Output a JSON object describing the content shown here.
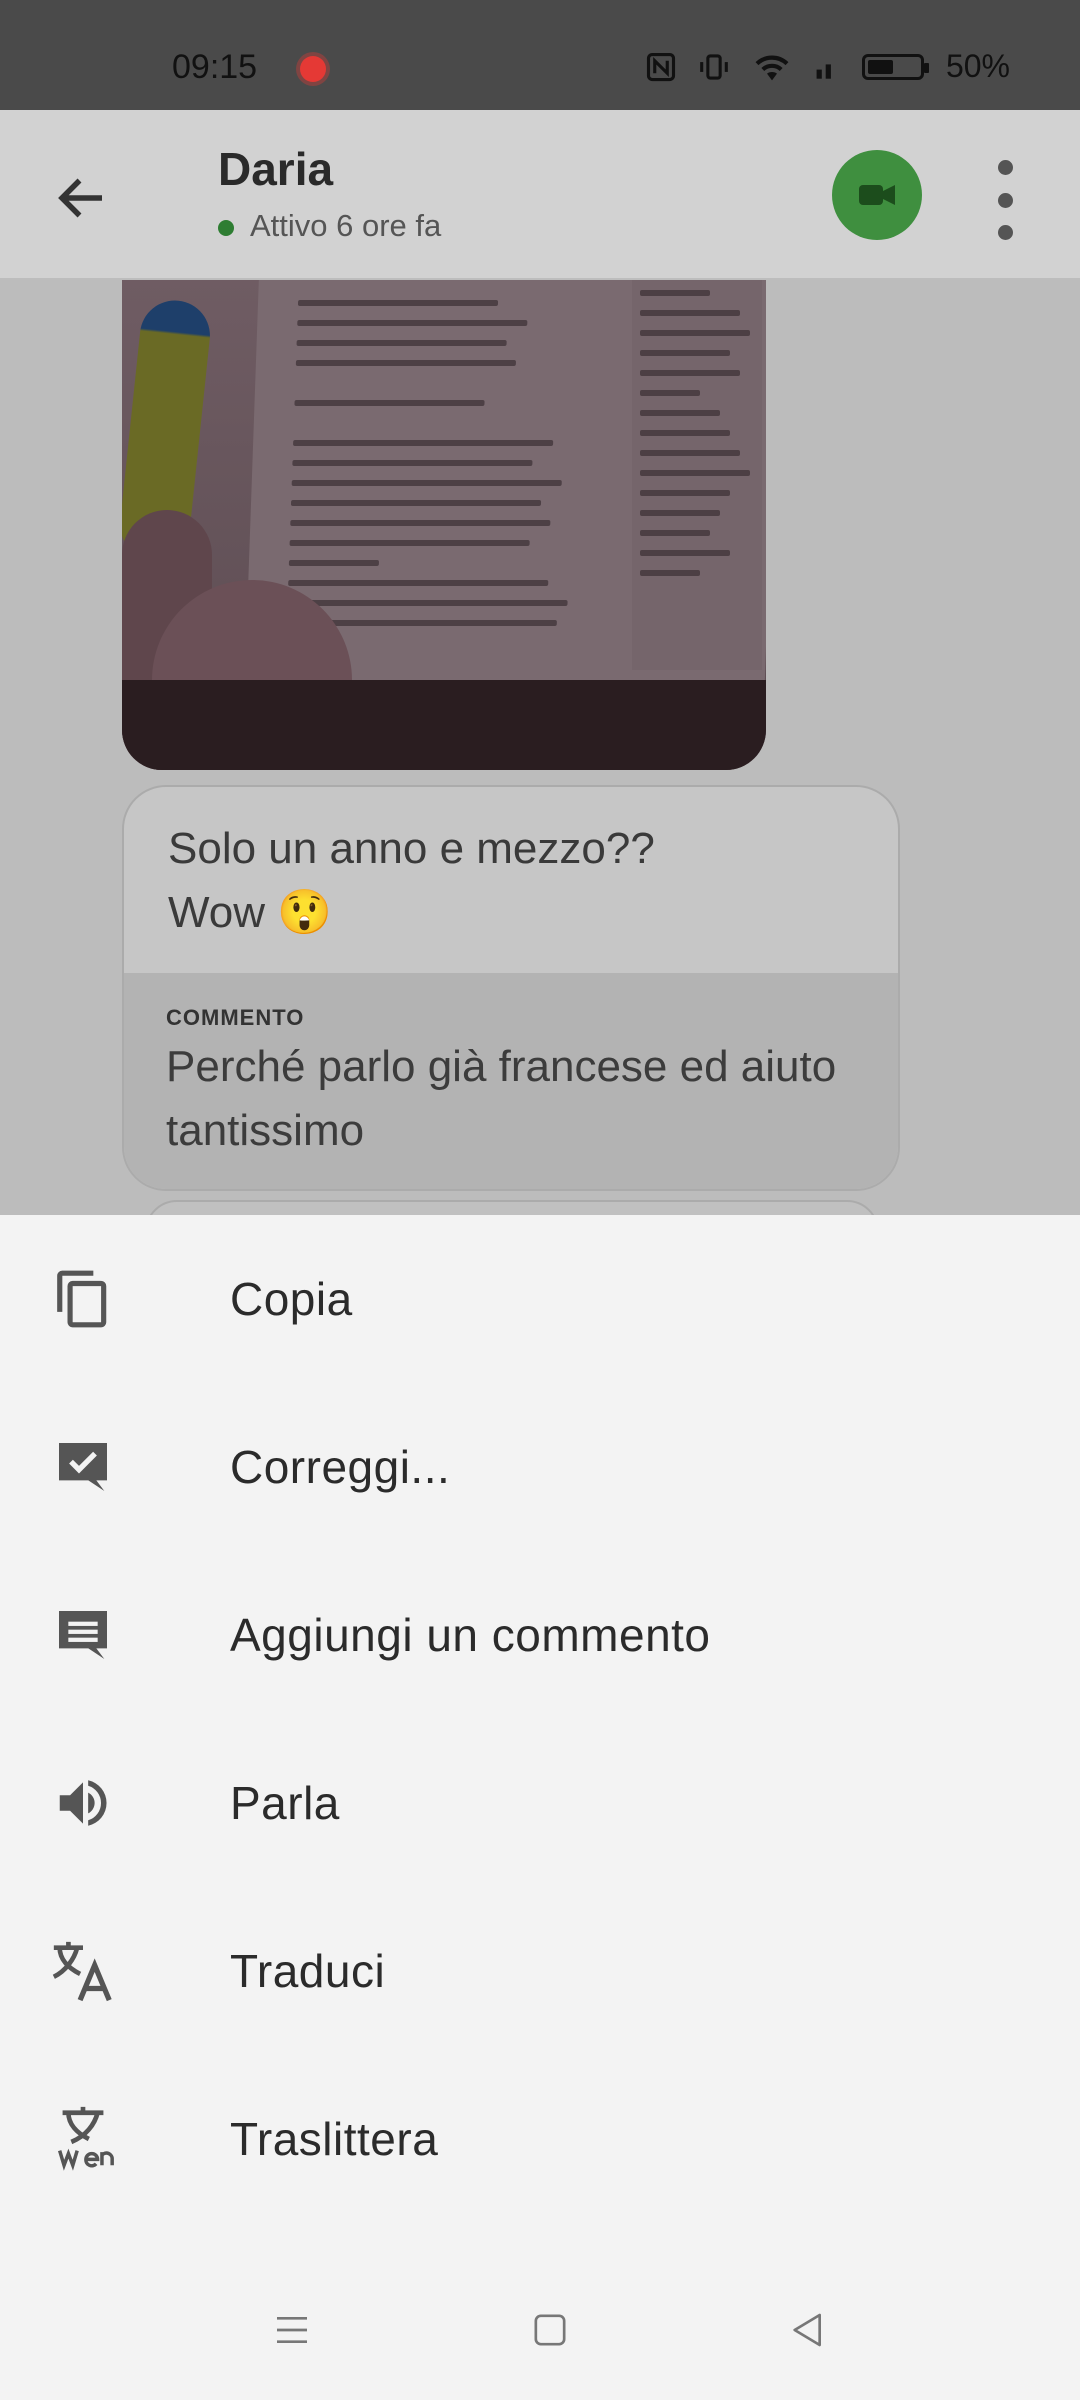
{
  "status_bar": {
    "time": "09:15",
    "battery_percent": "50%",
    "icons": [
      "nfc-icon",
      "vibrate-icon",
      "wifi-icon",
      "signal-icon",
      "battery-icon"
    ]
  },
  "header": {
    "contact_name": "Daria",
    "contact_status": "Attivo 6 ore fa",
    "status_color": "#2e7d32",
    "video_button_color": "#3f8f3f"
  },
  "chat": {
    "message_text": "Solo un anno e mezzo??\nWow 😲",
    "comment_label": "COMMENTO",
    "comment_text": "Perché parlo già francese ed aiuto tantissimo"
  },
  "context_menu": {
    "items": [
      {
        "label": "Copia",
        "icon": "copy-icon"
      },
      {
        "label": "Correggi...",
        "icon": "correct-icon"
      },
      {
        "label": "Aggiungi un commento",
        "icon": "comment-icon"
      },
      {
        "label": "Parla",
        "icon": "speaker-icon"
      },
      {
        "label": "Traduci",
        "icon": "translate-icon"
      },
      {
        "label": "Traslittera",
        "icon": "transliterate-icon"
      }
    ]
  },
  "nav_bar": {
    "buttons": [
      "menu-icon",
      "home-icon",
      "back-icon"
    ]
  }
}
